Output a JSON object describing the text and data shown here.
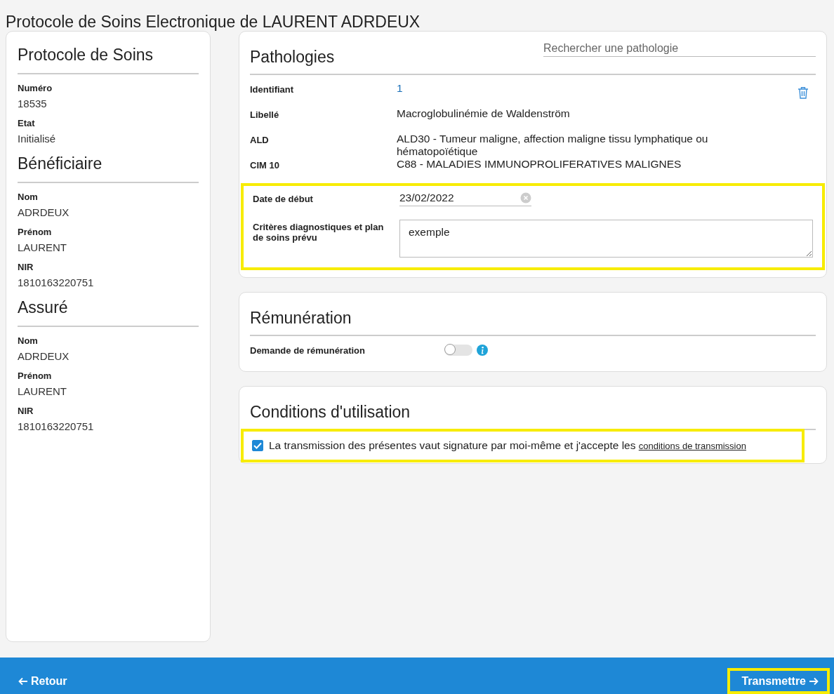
{
  "page_title": "Protocole de Soins Electronique de LAURENT ADRDEUX",
  "summary": [
    {
      "title": "Protocole de Soins",
      "fields": [
        {
          "label": "Numéro",
          "value": "18535"
        },
        {
          "label": "Etat",
          "value": "Initialisé"
        }
      ]
    },
    {
      "title": "Bénéficiaire",
      "fields": [
        {
          "label": "Nom",
          "value": "ADRDEUX"
        },
        {
          "label": "Prénom",
          "value": "LAURENT"
        },
        {
          "label": "NIR",
          "value": "1810163220751"
        }
      ]
    },
    {
      "title": "Assuré",
      "fields": [
        {
          "label": "Nom",
          "value": "ADRDEUX"
        },
        {
          "label": "Prénom",
          "value": "LAURENT"
        },
        {
          "label": "NIR",
          "value": "1810163220751"
        }
      ]
    }
  ],
  "pathologies": {
    "title": "Pathologies",
    "search": {
      "placeholder": "Rechercher une pathologie"
    },
    "details": [
      {
        "label": "Identifiant",
        "value": "1"
      },
      {
        "label": "Libellé",
        "value": "Macroglobulinémie de Waldenström"
      },
      {
        "label": "ALD",
        "value": "ALD30 - Tumeur maligne, affection maligne tissu lymphatique ou hématopoïétique"
      },
      {
        "label": "CIM 10",
        "value": "C88 - MALADIES IMMUNOPROLIFERATIVES MALIGNES"
      }
    ],
    "inputs": {
      "highlighted": true,
      "start_date": {
        "label": "Date de début",
        "value": "23/02/2022"
      },
      "criteria": {
        "label": "Critères diagnostiques et plan de soins prévu",
        "value": "exemple"
      }
    }
  },
  "remuneration": {
    "title": "Rémunération",
    "request": {
      "label": "Demande de rémunération",
      "on": false
    }
  },
  "conditions": {
    "title": "Conditions d'utilisation",
    "consent": {
      "highlighted": true,
      "checked": true,
      "text": "La transmission des présentes vaut signature par moi-même et j'accepte les",
      "link": "conditions de transmission"
    }
  },
  "footer": {
    "back": "Retour",
    "submit": {
      "label": "Transmettre",
      "highlighted": true
    }
  }
}
